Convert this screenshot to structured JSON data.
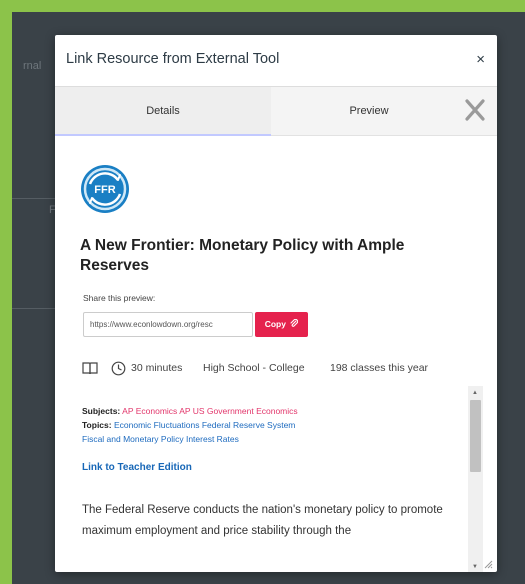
{
  "backdrop": {
    "left_text": "rnal",
    "left_text_2": "F"
  },
  "modal": {
    "title": "Link Resource from External Tool",
    "close_glyph": "×"
  },
  "tabs": [
    {
      "label": "Details"
    },
    {
      "label": "Preview"
    }
  ],
  "resource": {
    "logo_text": "FFR",
    "title": "A New Frontier: Monetary Policy with Ample Reserves",
    "share_label": "Share this preview:",
    "share_url": "https://www.econlowdown.org/resc",
    "copy_label": "Copy",
    "duration": "30 minutes",
    "grade": "High School - College",
    "classes": "198 classes this year",
    "subjects_label": "Subjects:",
    "subjects": [
      "AP Economics",
      "AP US Government",
      "Economics"
    ],
    "topics_label": "Topics:",
    "topics": [
      "Economic Fluctuations",
      "Federal Reserve System",
      "Fiscal and Monetary Policy",
      "Interest Rates"
    ],
    "teacher_link": "Link to Teacher Edition",
    "description": "The Federal Reserve conducts the nation's monetary policy to promote maximum employment and price stability through the"
  },
  "colors": {
    "accent_pink": "#e5224d",
    "link_blue": "#1767b7",
    "logo_blue": "#1a7fc4"
  }
}
